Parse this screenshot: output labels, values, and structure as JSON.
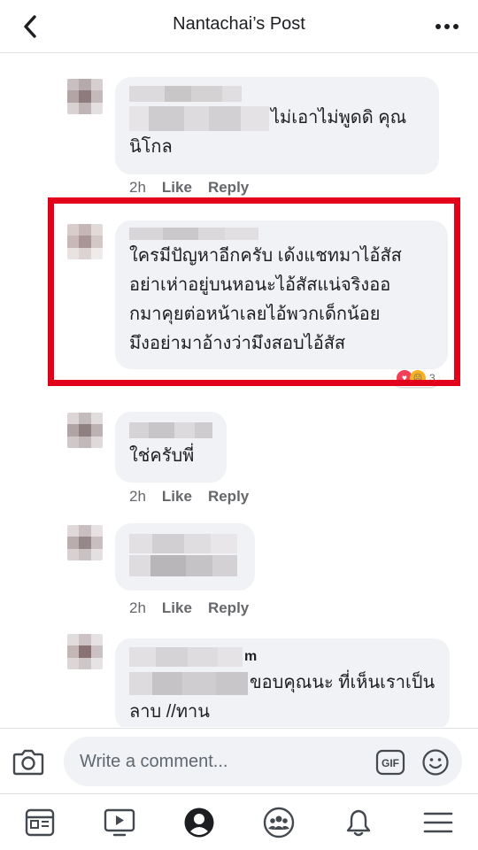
{
  "header": {
    "title": "Nantachai’s Post",
    "back_icon": "chevron-left-icon",
    "more_icon": "more-horizontal-icon"
  },
  "comments": [
    {
      "text_visible": "ไม่เอาไม่พูดดิ คุณ",
      "text_line2": "นิโกล",
      "time": "2h",
      "like": "Like",
      "reply": "Reply"
    },
    {
      "lines": [
        "ใครมีปัญหาอีกครับ เด้งแชทมาไอ้สัส",
        "อย่าเห่าอยู่บนหอนะไอ้สัสแน่จริงออ",
        "กมาคุยต่อหน้าเลยไอ้พวกเด็กน้อย",
        "มึงอย่ามาอ้างว่ามึงสอบไอ้สัส"
      ],
      "reaction_count": "3",
      "highlight_color": "#e3001b"
    },
    {
      "text": "ใช่ครับพี่",
      "time": "2h",
      "like": "Like",
      "reply": "Reply"
    },
    {
      "time": "2h",
      "like": "Like",
      "reply": "Reply"
    },
    {
      "name_suffix": "m",
      "text_visible": "ขอบคุณนะ ที่เห็นเราเป็น",
      "text_line2": "ลาบ //ทาน"
    }
  ],
  "composer": {
    "placeholder": "Write a comment...",
    "camera_icon": "camera-icon",
    "gif_icon": "gif-icon",
    "emoji_icon": "emoji-icon"
  },
  "bottom_nav": {
    "items": [
      "news-feed-icon",
      "watch-icon",
      "profile-icon",
      "groups-icon",
      "notifications-icon",
      "menu-icon"
    ]
  },
  "colors": {
    "bubble": "#f0f2f5",
    "highlight": "#e3001b",
    "secondary_text": "#65676b"
  }
}
